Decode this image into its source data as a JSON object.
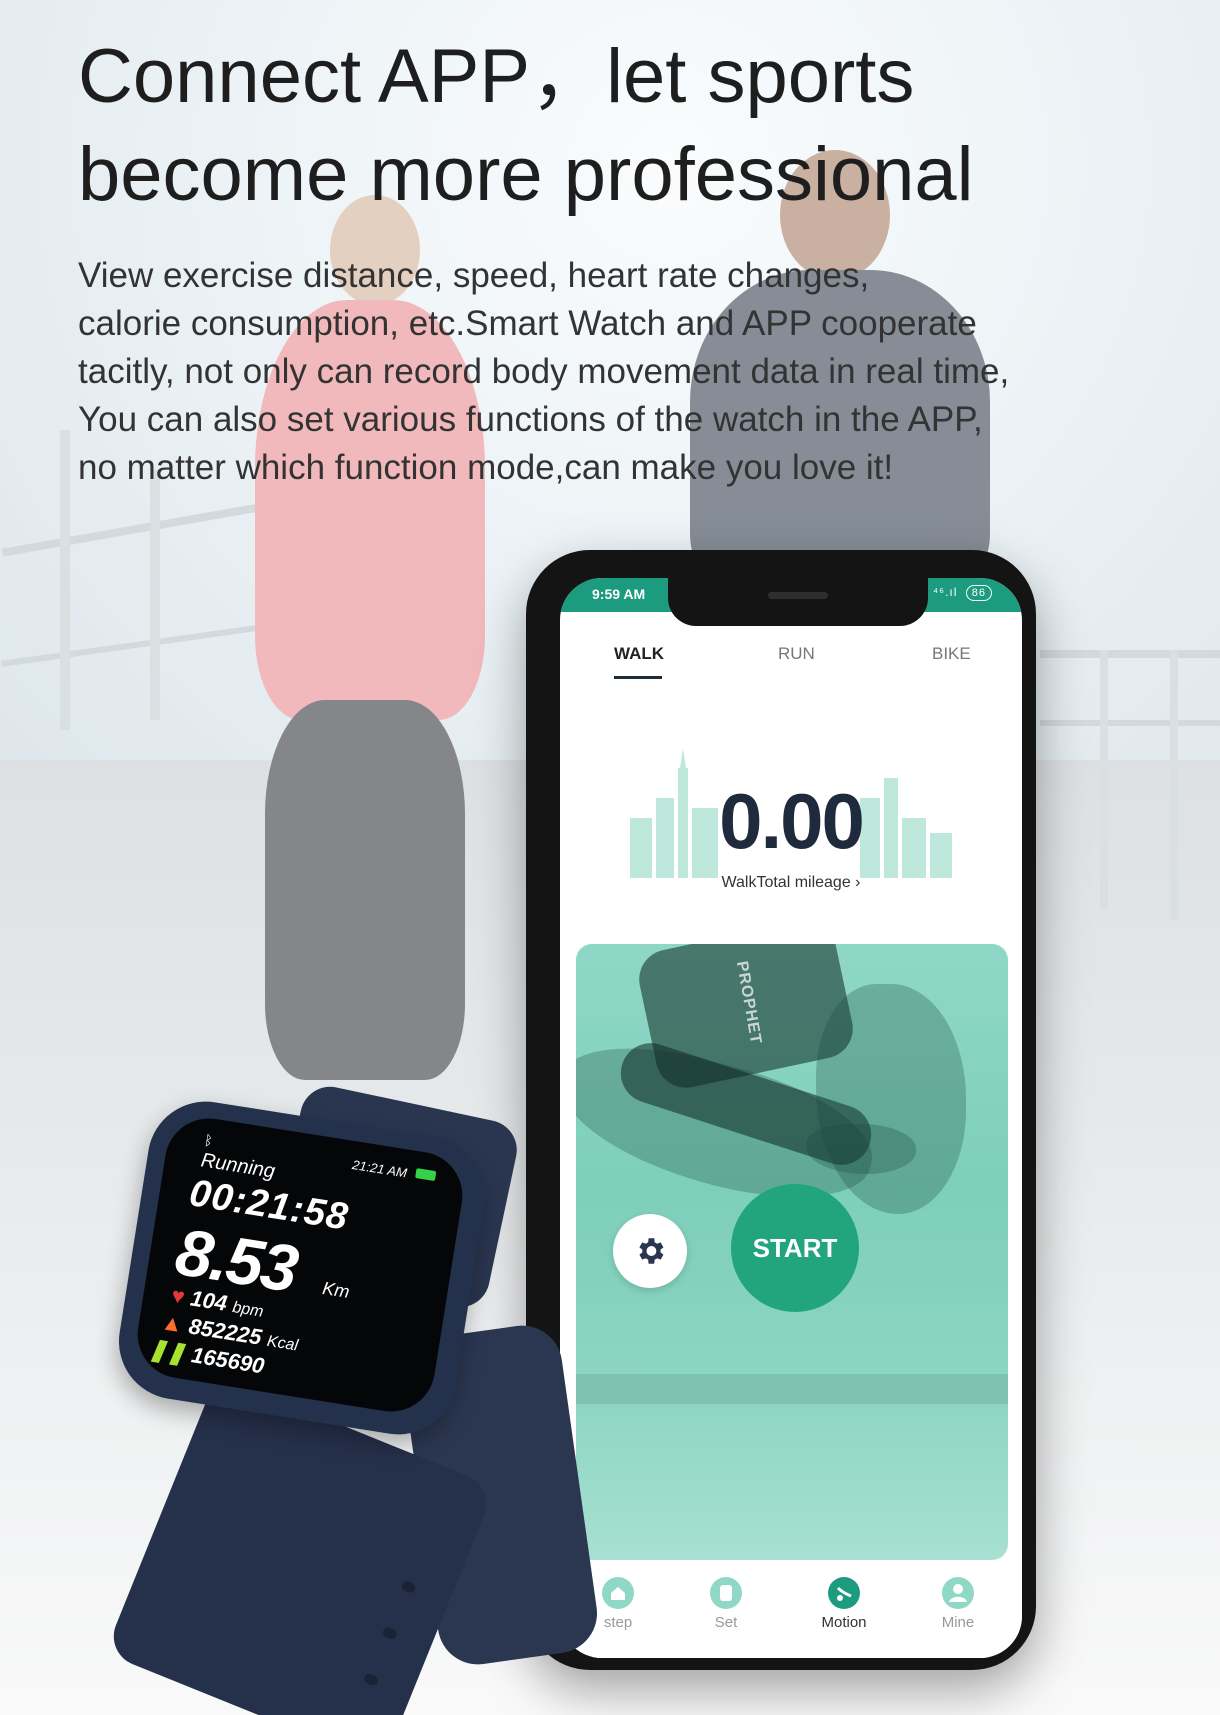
{
  "headline": {
    "line1": "Connect APP，let sports",
    "line2": "become more professional"
  },
  "description": {
    "line1": "View exercise distance, speed, heart rate changes,",
    "line2": "calorie consumption, etc.Smart Watch and APP cooperate",
    "line3": "tacitly, not only can record body movement data in real time,",
    "line4": "You can also set various functions of the watch in the APP,",
    "line5": "no matter which function mode,can make you love it!"
  },
  "phone": {
    "status_bar": {
      "time": "9:59 AM",
      "signal": "⁴⁶.ıl",
      "battery": "86"
    },
    "tabs": [
      {
        "label": "WALK",
        "active": true
      },
      {
        "label": "RUN",
        "active": false
      },
      {
        "label": "BIKE",
        "active": false
      }
    ],
    "total_mileage_value": "0.00",
    "total_mileage_link": "WalkTotal mileage ›",
    "banner_text": "PROPHET",
    "start_label": "START",
    "settings_icon": "gear-icon",
    "bottom_nav": [
      {
        "label": "step",
        "icon": "home-icon",
        "active": false
      },
      {
        "label": "Set",
        "icon": "watch-icon",
        "active": false
      },
      {
        "label": "Motion",
        "icon": "motion-icon",
        "active": true
      },
      {
        "label": "Mine",
        "icon": "user-icon",
        "active": false
      }
    ],
    "accent_color": "#1d9b7f"
  },
  "watch": {
    "bluetooth_icon": "bluetooth-icon",
    "time": "21:21 AM",
    "mode": "Running",
    "elapsed": "00:21:58",
    "distance": "8.53",
    "distance_unit": "Km",
    "heart_rate": "104",
    "heart_rate_unit": "bpm",
    "calories": "852225",
    "calories_unit": "Kcal",
    "steps": "165690"
  }
}
